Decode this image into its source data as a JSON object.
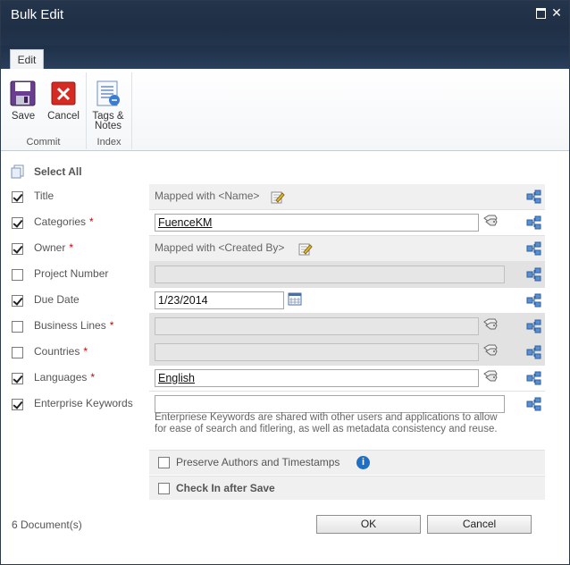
{
  "window": {
    "title": "Bulk Edit"
  },
  "ribbon": {
    "tab": "Edit",
    "buttons": {
      "save": "Save",
      "cancel": "Cancel",
      "tags_line1": "Tags &",
      "tags_line2": "Notes"
    },
    "groups": {
      "commit": "Commit",
      "index": "Index"
    }
  },
  "form": {
    "select_all": "Select All",
    "fields": [
      {
        "label": "Title",
        "required": false,
        "checked": true,
        "value": "Mapped with <Name>"
      },
      {
        "label": "Categories",
        "required": true,
        "checked": true,
        "value": "FuenceKM"
      },
      {
        "label": "Owner",
        "required": true,
        "checked": true,
        "value": "Mapped with <Created By>"
      },
      {
        "label": "Project Number",
        "required": false,
        "checked": false,
        "value": ""
      },
      {
        "label": "Due Date",
        "required": false,
        "checked": true,
        "value": "1/23/2014"
      },
      {
        "label": "Business Lines",
        "required": true,
        "checked": false,
        "value": ""
      },
      {
        "label": "Countries",
        "required": true,
        "checked": false,
        "value": ""
      },
      {
        "label": "Languages",
        "required": true,
        "checked": true,
        "value": "English"
      },
      {
        "label": "Enterprise Keywords",
        "required": false,
        "checked": true,
        "value": ""
      }
    ],
    "required_marker": "*",
    "keywords_description": "Enterpriese Keywords are shared with other users and applications to allow for ease of search and fitlering, as well as metadata consistency and reuse.",
    "preserve_label": "Preserve Authors and Timestamps",
    "checkin_label": "Check In after Save"
  },
  "footer": {
    "count": "6  Document(s)",
    "ok": "OK",
    "cancel": "Cancel"
  },
  "colors": {
    "titlebar": "#1f2f45",
    "required": "#cc0000",
    "info": "#1f6fc5"
  }
}
